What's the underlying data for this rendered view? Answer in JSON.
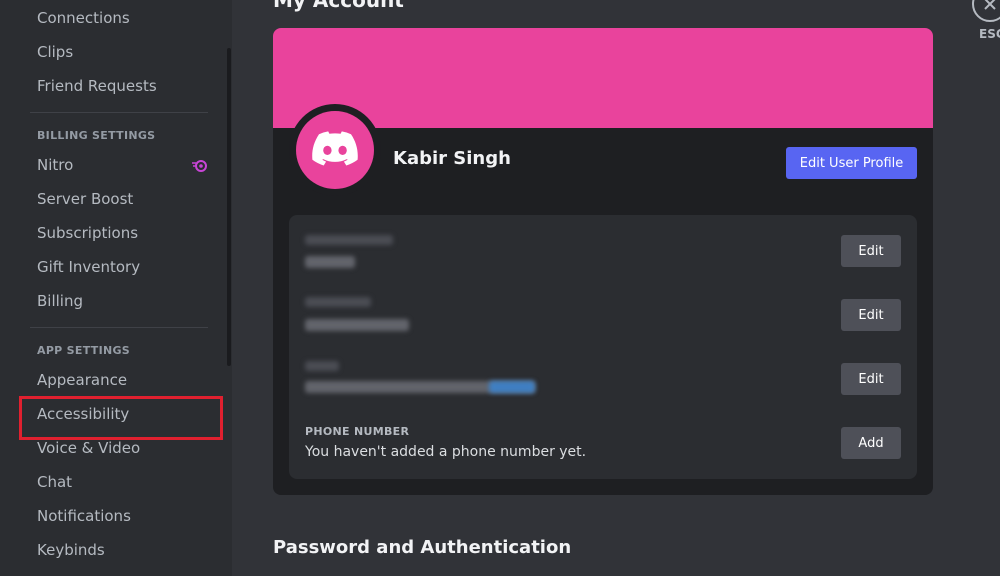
{
  "sidebar": {
    "user_settings_items": [
      {
        "label": "Connections"
      },
      {
        "label": "Clips"
      },
      {
        "label": "Friend Requests"
      }
    ],
    "billing_header": "BILLING SETTINGS",
    "billing_items": [
      {
        "label": "Nitro",
        "icon": "nitro-icon"
      },
      {
        "label": "Server Boost"
      },
      {
        "label": "Subscriptions"
      },
      {
        "label": "Gift Inventory"
      },
      {
        "label": "Billing"
      }
    ],
    "app_header": "APP SETTINGS",
    "app_items": [
      {
        "label": "Appearance"
      },
      {
        "label": "Accessibility",
        "highlighted": true
      },
      {
        "label": "Voice & Video"
      },
      {
        "label": "Chat"
      },
      {
        "label": "Notifications"
      },
      {
        "label": "Keybinds"
      }
    ]
  },
  "main": {
    "title": "My Account",
    "close_label": "ESC",
    "profile": {
      "username": "Kabir Singh",
      "edit_profile_label": "Edit User Profile"
    },
    "fields": [
      {
        "blurred": true,
        "button": "Edit"
      },
      {
        "blurred": true,
        "button": "Edit"
      },
      {
        "blurred": true,
        "button": "Edit"
      },
      {
        "label": "PHONE NUMBER",
        "value": "You haven't added a phone number yet.",
        "button": "Add"
      }
    ],
    "section_title": "Password and Authentication"
  },
  "colors": {
    "banner": "#e9439c",
    "accent": "#5865f2",
    "highlight": "#e0202f",
    "nitro": "#c845d6"
  }
}
